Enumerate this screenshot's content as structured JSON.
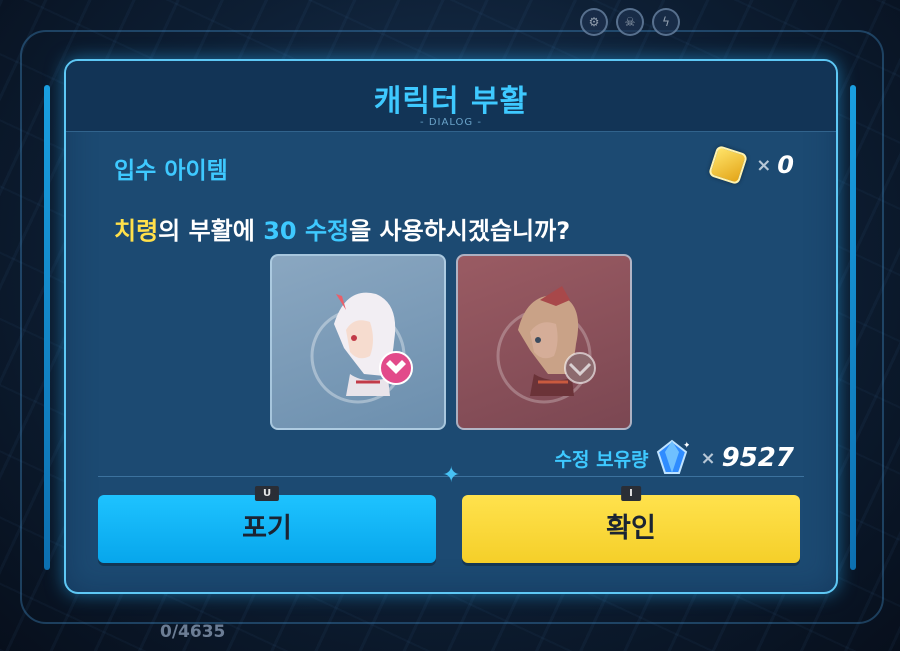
{
  "background": {
    "top_icons": [
      "gear-icon",
      "skull-icon",
      "lightning-icon"
    ],
    "progress_text": "0/4635"
  },
  "dialog": {
    "title": "캐릭터 부활",
    "subtitle": "- DIALOG -",
    "section_label": "입수 아이템",
    "coin": {
      "icon": "coin-icon",
      "multiplier": "×",
      "count": "0"
    },
    "question": {
      "character": "치령",
      "part1": "의 부활에 ",
      "amount": "30 수정",
      "part2": "을 사용하시겠습니까?"
    },
    "portraits": [
      {
        "name": "white-haired-valkyrie",
        "badge": "crest-pink"
      },
      {
        "name": "blonde-valkyrie-unavailable",
        "badge": "crest-grey"
      }
    ],
    "crystal": {
      "label": "수정 보유량",
      "icon": "crystal-icon",
      "multiplier": "×",
      "count": "9527"
    },
    "buttons": {
      "cancel": {
        "label": "포기",
        "hotkey": "U",
        "color": "#07a6ec"
      },
      "confirm": {
        "label": "확인",
        "hotkey": "I",
        "color": "#f5cf29"
      }
    }
  },
  "colors": {
    "accent": "#3ec9ff",
    "highlight": "#ffe04a",
    "panel": "#1c4a72"
  }
}
